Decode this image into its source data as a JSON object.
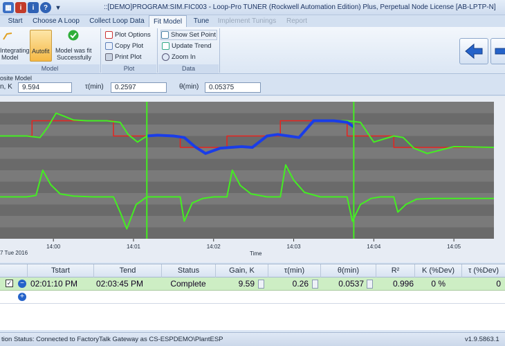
{
  "titlebar": {
    "title": "::[DEMO]PROGRAM:SIM.FIC003 - Loop-Pro TUNER (Rockwell Automation Edition) Plus, Perpetual Node License [AB-LPTP-N]",
    "dropdown_glyph": "▾"
  },
  "tabs": [
    "Start",
    "Choose A Loop",
    "Collect Loop Data",
    "Fit Model",
    "Tune",
    "Implement Tunings",
    "Report"
  ],
  "ribbon": {
    "model_group": {
      "label": "Model",
      "integrating_label": "Integrating",
      "model_label": "Model",
      "autofit_label": "Autofit",
      "fit_status_line1": "Model was fit",
      "fit_status_line2": "Successfully"
    },
    "plot_group": {
      "label": "Plot",
      "options": "Plot Options",
      "copy": "Copy Plot",
      "print": "Print Plot"
    },
    "data_group": {
      "label": "Data",
      "show_set_point": "Show Set Point",
      "update_trend": "Update Trend",
      "zoom_in": "Zoom In"
    }
  },
  "model_params": {
    "heading": "osite Model",
    "gain_label": "n, K",
    "gain_value": "9.594",
    "tau_label": "τ(min)",
    "tau_value": "0.2597",
    "theta_label": "θ(min)",
    "theta_value": "0.05375"
  },
  "chart_data": {
    "type": "line",
    "xlabel": "Time",
    "date_label": "7 Tue 2016",
    "x_ticks": [
      "14:00",
      "14:01",
      "14:02",
      "14:03",
      "14:04",
      "14:05"
    ],
    "x_range": [
      "13:59:20",
      "14:05:30"
    ],
    "fit_window": [
      "14:01:10",
      "14:03:45"
    ],
    "series": [
      {
        "color": "#e8231e",
        "x": [
          "13:59:20",
          "13:59:44",
          "13:59:44",
          "14:00:45",
          "14:00:45",
          "14:01:35",
          "14:01:35",
          "14:02:10",
          "14:02:10",
          "14:02:50",
          "14:02:50",
          "14:03:40",
          "14:03:40",
          "14:04:15",
          "14:04:15",
          "14:05:30"
        ],
        "values": [
          50,
          50,
          70,
          70,
          50,
          50,
          35,
          35,
          50,
          50,
          70,
          70,
          50,
          50,
          35,
          35
        ]
      },
      {
        "color": "#44ee22",
        "x": [
          "13:59:20",
          "13:59:40",
          "13:59:50",
          "13:59:56",
          "14:00:02",
          "14:00:08",
          "14:00:15",
          "14:00:25",
          "14:00:40",
          "14:00:50",
          "14:00:56",
          "14:01:03",
          "14:01:10",
          "14:01:18",
          "14:01:30",
          "14:01:38",
          "14:01:46",
          "14:01:54",
          "14:02:05",
          "14:02:13",
          "14:02:21",
          "14:02:29",
          "14:02:40",
          "14:02:48",
          "14:02:56",
          "14:03:04",
          "14:03:15",
          "14:03:30",
          "14:03:40",
          "14:03:50",
          "14:04:00",
          "14:04:15",
          "14:04:22",
          "14:04:30",
          "14:04:40",
          "14:05:00",
          "14:05:30"
        ],
        "values": [
          50,
          50,
          48,
          62,
          80,
          76,
          71,
          70,
          70,
          68,
          52,
          42,
          50,
          51,
          50,
          48,
          36,
          27,
          34,
          35,
          36,
          35,
          50,
          52,
          50,
          48,
          70,
          70,
          70,
          68,
          42,
          50,
          48,
          34,
          27,
          36,
          35
        ]
      },
      {
        "color": "#1a3de8",
        "x": [
          "14:01:10",
          "14:01:18",
          "14:01:30",
          "14:01:38",
          "14:01:46",
          "14:01:54",
          "14:02:05",
          "14:02:13",
          "14:02:21",
          "14:02:29",
          "14:02:40",
          "14:02:48",
          "14:02:56",
          "14:03:04",
          "14:03:15",
          "14:03:30",
          "14:03:40",
          "14:03:45"
        ],
        "values": [
          50,
          51,
          50,
          48,
          36,
          27,
          34,
          35,
          36,
          35,
          50,
          52,
          50,
          48,
          70,
          70,
          68,
          62
        ]
      },
      {
        "color": "#44ee22",
        "x": [
          "13:59:20",
          "13:59:40",
          "13:59:47",
          "13:59:52",
          "13:59:58",
          "14:00:05",
          "14:00:15",
          "14:00:30",
          "14:00:45",
          "14:00:50",
          "14:00:55",
          "14:01:02",
          "14:01:10",
          "14:01:18",
          "14:01:28",
          "14:01:35",
          "14:01:38",
          "14:01:44",
          "14:01:52",
          "14:02:00",
          "14:02:10",
          "14:02:14",
          "14:02:20",
          "14:02:28",
          "14:02:40",
          "14:02:50",
          "14:02:54",
          "14:03:00",
          "14:03:08",
          "14:03:20",
          "14:03:40",
          "14:03:44",
          "14:03:50",
          "14:03:58",
          "14:04:05",
          "14:04:15",
          "14:04:18",
          "14:04:24",
          "14:04:32",
          "14:04:45",
          "14:05:00",
          "14:05:30"
        ],
        "values": [
          -30,
          -30,
          -28,
          5,
          -14,
          -26,
          -29,
          -30,
          -30,
          -50,
          -72,
          -40,
          -30,
          -30,
          -30,
          -30,
          -62,
          -38,
          -32,
          -30,
          -30,
          5,
          -15,
          -26,
          -30,
          -30,
          12,
          -8,
          -24,
          -30,
          -30,
          -62,
          -40,
          -32,
          -30,
          -30,
          -50,
          -40,
          -33,
          -32,
          -32,
          -32
        ]
      }
    ]
  },
  "table": {
    "headers": [
      "Tstart",
      "Tend",
      "Status",
      "Gain, K",
      "τ(min)",
      "θ(min)",
      "R²",
      "K (%Dev)",
      "τ (%Dev)"
    ],
    "row": {
      "checked": "✓",
      "remove": "−",
      "tstart": "02:01:10 PM",
      "tend": "02:03:45 PM",
      "status": "Complete",
      "gain": "9.59",
      "tau": "0.26",
      "theta": "0.0537",
      "r2": "0.996",
      "k_dev": "0 %",
      "tau_dev": "0"
    },
    "add": "+"
  },
  "statusbar": {
    "connection": "tion Status: Connected to FactoryTalk Gateway as CS-ESPDEMO\\PlantESP",
    "version": "v1.9.5863.1"
  },
  "colors": {
    "setpoint": "#e8231e",
    "process": "#44ee22",
    "model_fit": "#1a3de8",
    "fit_markers": "#44ee22",
    "plot_bg": "#6a6a6a",
    "row_highlight": "#cdeec4"
  }
}
